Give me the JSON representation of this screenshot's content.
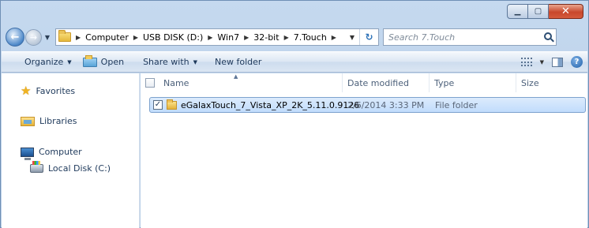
{
  "address": {
    "crumbs": [
      "Computer",
      "USB DISK (D:)",
      "Win7",
      "32-bit",
      "7.Touch"
    ],
    "search_placeholder": "Search 7.Touch"
  },
  "toolbar": {
    "organize": "Organize",
    "open": "Open",
    "share_with": "Share with",
    "new_folder": "New folder"
  },
  "nav": {
    "favorites": "Favorites",
    "libraries": "Libraries",
    "computer": "Computer",
    "local_disk": "Local Disk (C:)"
  },
  "columns": {
    "name": "Name",
    "date_modified": "Date modified",
    "type": "Type",
    "size": "Size"
  },
  "files": [
    {
      "name": "eGalaxTouch_7_Vista_XP_2K_5.11.0.9126",
      "date_modified": "2/6/2014 3:33 PM",
      "type": "File folder",
      "size": ""
    }
  ]
}
